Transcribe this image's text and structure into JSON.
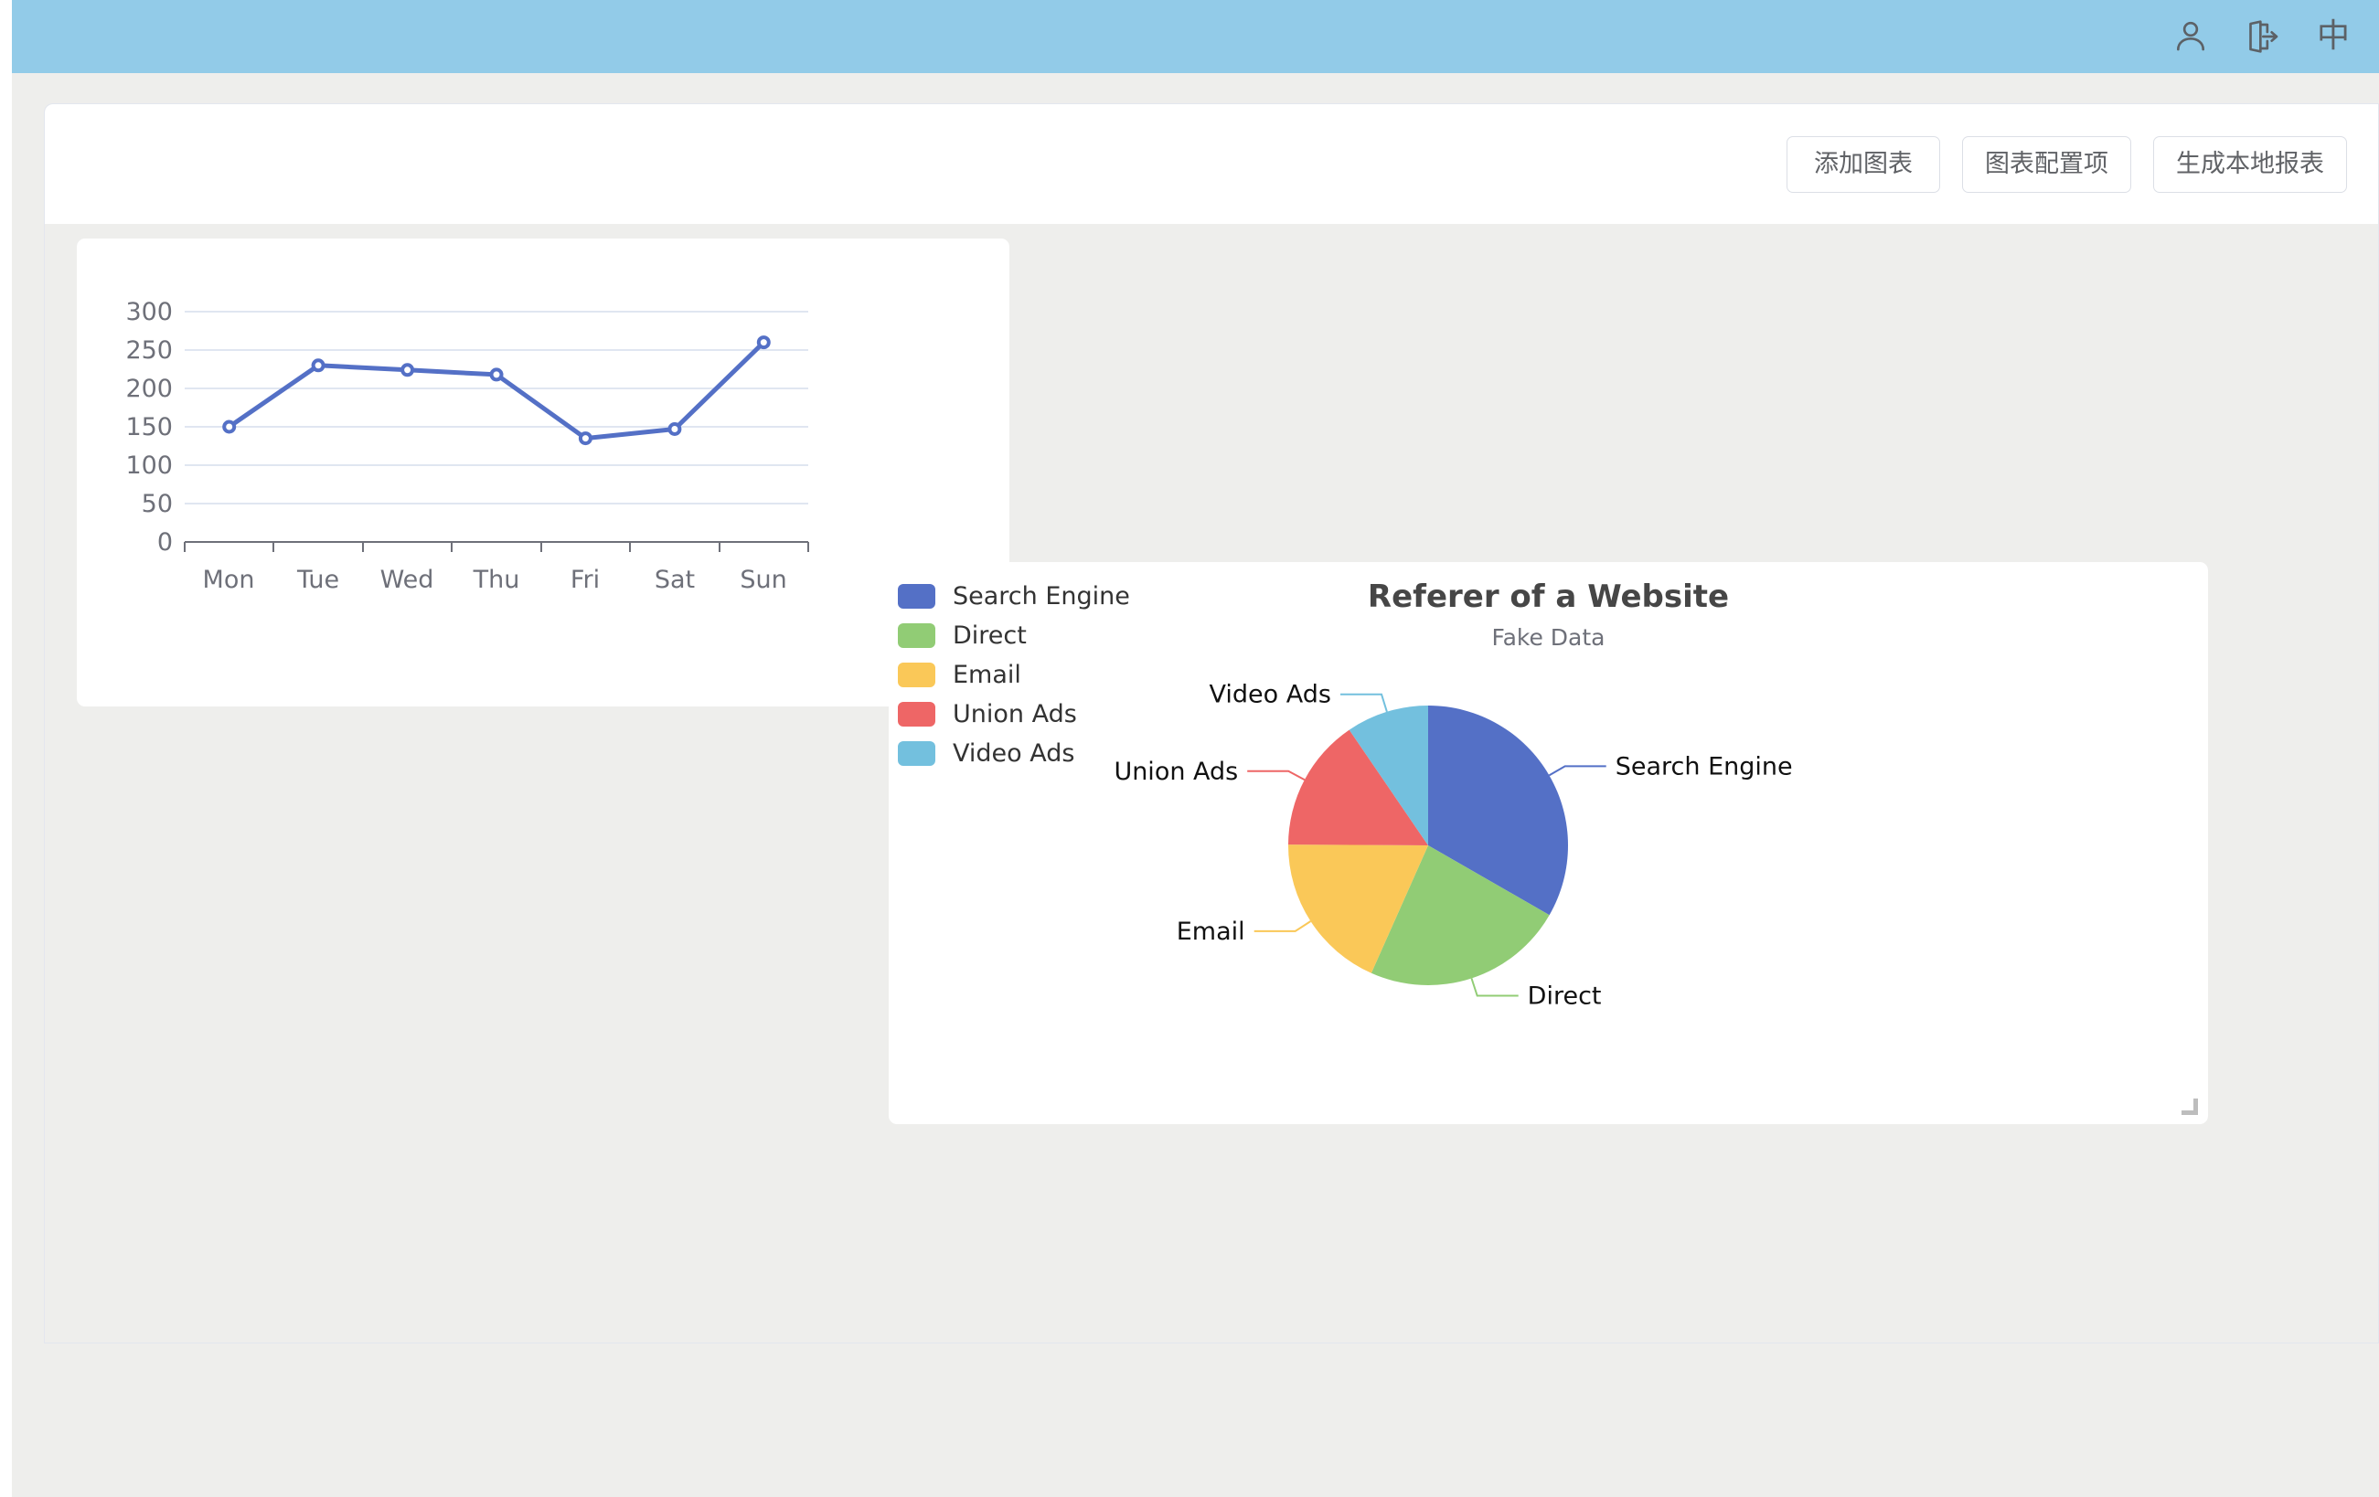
{
  "header": {
    "icons": [
      {
        "name": "user-icon",
        "label": "user"
      },
      {
        "name": "logout-icon",
        "label": "logout"
      },
      {
        "name": "language-icon",
        "label": "中"
      }
    ]
  },
  "toolbar": {
    "add_chart_label": "添加图表",
    "chart_config_label": "图表配置项",
    "generate_report_label": "生成本地报表"
  },
  "colors": {
    "header_bg": "#92cbe8",
    "page_bg": "#eeeeec",
    "card_bg": "#ffffff",
    "line_series": "#5470c6",
    "axis_text": "#6e7079",
    "gridline": "#e0e6f1",
    "palette": [
      "#5470c6",
      "#91cc75",
      "#fac858",
      "#ee6666",
      "#73c0de"
    ]
  },
  "chart_data": [
    {
      "id": "line-chart",
      "type": "line",
      "title": "",
      "xlabel": "",
      "ylabel": "",
      "categories": [
        "Mon",
        "Tue",
        "Wed",
        "Thu",
        "Fri",
        "Sat",
        "Sun"
      ],
      "values": [
        150,
        230,
        224,
        218,
        135,
        147,
        260
      ],
      "series": [
        {
          "name": "",
          "values": [
            150,
            230,
            224,
            218,
            135,
            147,
            260
          ]
        }
      ],
      "ylim": [
        0,
        300
      ],
      "yticks": [
        0,
        50,
        100,
        150,
        200,
        250,
        300
      ],
      "ytick_labels": [
        "0",
        "50",
        "100",
        "150",
        "200",
        "250",
        "300"
      ],
      "grid": true,
      "legend": false,
      "symbol": "circle"
    },
    {
      "id": "pie-chart",
      "type": "pie",
      "title": "Referer of a Website",
      "subtitle": "Fake Data",
      "legend_position": "left",
      "categories": [
        "Search Engine",
        "Direct",
        "Email",
        "Union Ads",
        "Video Ads"
      ],
      "values": [
        1048,
        735,
        580,
        484,
        300
      ],
      "colors": [
        "#5470c6",
        "#91cc75",
        "#fac858",
        "#ee6666",
        "#73c0de"
      ],
      "labels": [
        {
          "name": "Search Engine",
          "side": "right"
        },
        {
          "name": "Direct",
          "side": "right"
        },
        {
          "name": "Email",
          "side": "left"
        },
        {
          "name": "Union Ads",
          "side": "left"
        },
        {
          "name": "Video Ads",
          "side": "left"
        }
      ],
      "legend_entries": [
        "Search Engine",
        "Direct",
        "Email",
        "Union Ads",
        "Video Ads"
      ]
    }
  ]
}
